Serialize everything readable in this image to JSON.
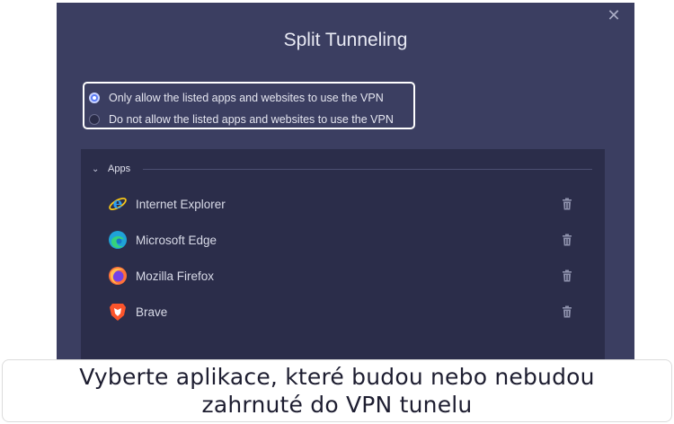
{
  "dialog": {
    "title": "Split Tunneling",
    "close_glyph": "✕",
    "mode_options": [
      {
        "label": "Only allow the listed apps and websites to use the VPN",
        "selected": true
      },
      {
        "label": "Do not allow the listed apps and websites to use the VPN",
        "selected": false
      }
    ],
    "apps_section": {
      "title": "Apps",
      "chevron": "⌄",
      "items": [
        {
          "name": "Internet Explorer",
          "icon": "internet-explorer-icon"
        },
        {
          "name": "Microsoft Edge",
          "icon": "microsoft-edge-icon"
        },
        {
          "name": "Mozilla Firefox",
          "icon": "firefox-icon"
        },
        {
          "name": "Brave",
          "icon": "brave-icon"
        }
      ]
    }
  },
  "caption": {
    "line1": "Vyberte aplikace, které budou nebo nebudou",
    "line2": "zahrnuté do VPN tunelu"
  },
  "colors": {
    "dialog_bg": "#3b3e61",
    "panel_bg": "#2b2d4a",
    "accent": "#5b7cf5"
  }
}
